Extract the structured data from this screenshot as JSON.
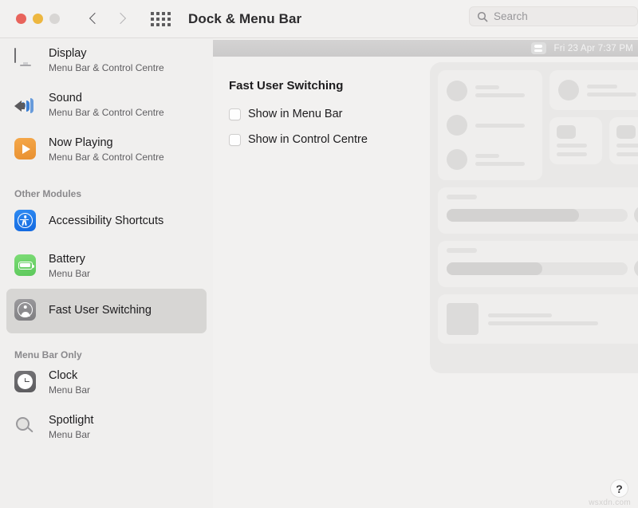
{
  "window": {
    "title": "Dock & Menu Bar",
    "traffic_lights": [
      "close",
      "minimize",
      "zoom"
    ],
    "back_label": "Back",
    "forward_label": "Forward",
    "show_all_label": "Show All"
  },
  "search": {
    "placeholder": "Search",
    "value": ""
  },
  "sidebar": {
    "items": [
      {
        "label": "Display",
        "sublabel": "Menu Bar & Control Centre",
        "icon": "display-icon",
        "selected": false
      },
      {
        "label": "Sound",
        "sublabel": "Menu Bar & Control Centre",
        "icon": "sound-icon",
        "selected": false
      },
      {
        "label": "Now Playing",
        "sublabel": "Menu Bar & Control Centre",
        "icon": "now-playing-icon",
        "selected": false
      }
    ],
    "group_other_modules": "Other Modules",
    "other_modules": [
      {
        "label": "Accessibility Shortcuts",
        "sublabel": "",
        "icon": "accessibility-icon",
        "selected": false
      },
      {
        "label": "Battery",
        "sublabel": "Menu Bar",
        "icon": "battery-icon",
        "selected": false
      },
      {
        "label": "Fast User Switching",
        "sublabel": "",
        "icon": "fast-user-switching-icon",
        "selected": true
      }
    ],
    "group_menu_bar_only": "Menu Bar Only",
    "menu_bar_only": [
      {
        "label": "Clock",
        "sublabel": "Menu Bar",
        "icon": "clock-icon",
        "selected": false
      },
      {
        "label": "Spotlight",
        "sublabel": "Menu Bar",
        "icon": "spotlight-icon",
        "selected": false
      }
    ]
  },
  "main": {
    "panel_title": "Fast User Switching",
    "checkboxes": [
      {
        "label": "Show in Menu Bar",
        "checked": false
      },
      {
        "label": "Show in Control Centre",
        "checked": false
      }
    ],
    "menu_bar_preview": {
      "clock_text": "Fri 23 Apr  7:37 PM",
      "control_centre_icon": "control-centre-icon"
    },
    "help_button": "?",
    "watermark": "wsxdn.com"
  },
  "colors": {
    "close": "#e8645c",
    "minimize": "#edb740",
    "zoom": "#d8d6d4",
    "sidebar_bg": "#f0efee",
    "selected_row": "#d7d6d4",
    "accent_blue": "#2f8bf2",
    "battery_green": "#7ddc76",
    "now_playing_orange": "#f5a84a",
    "menu_strip": "#d2d1d1"
  }
}
